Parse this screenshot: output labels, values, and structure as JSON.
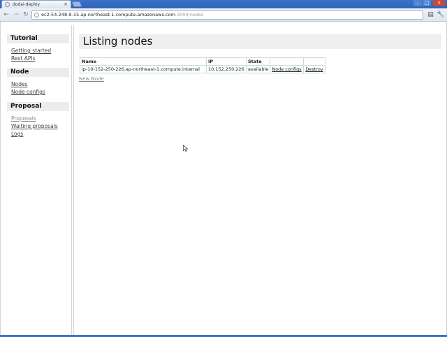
{
  "browser": {
    "tab_title": "dodai-deploy",
    "tab_close": "×",
    "url_host": "ec2-54-248-9-15.ap-northeast-1.compute.amazonaws.com",
    "url_rest": ":3000/nodes",
    "window_min": "–",
    "window_max": "□",
    "window_close": "×",
    "back_glyph": "←",
    "forward_glyph": "→",
    "reload_glyph": "↻",
    "star_glyph": "☆",
    "page_glyph": "▤",
    "wrench_glyph": "🔧"
  },
  "sidebar": {
    "sections": [
      {
        "title": "Tutorial",
        "links": [
          "Getting started",
          "Rest APIs"
        ]
      },
      {
        "title": "Node",
        "links": [
          "Nodes",
          "Node configs"
        ]
      },
      {
        "title": "Proposal",
        "links": [
          "Proposals",
          "Waiting proposals",
          "Logs"
        ]
      }
    ]
  },
  "main": {
    "title": "Listing nodes",
    "table": {
      "headers": [
        "Name",
        "IP",
        "State",
        "",
        ""
      ],
      "rows": [
        {
          "name": "ip-10-152-250-226.ap-northeast-1.compute.internal",
          "ip": "10.152.250.226",
          "state": "available",
          "node_configs_link": "Node configs",
          "destroy_link": "Destroy"
        }
      ]
    },
    "new_node_link": "New Node"
  }
}
